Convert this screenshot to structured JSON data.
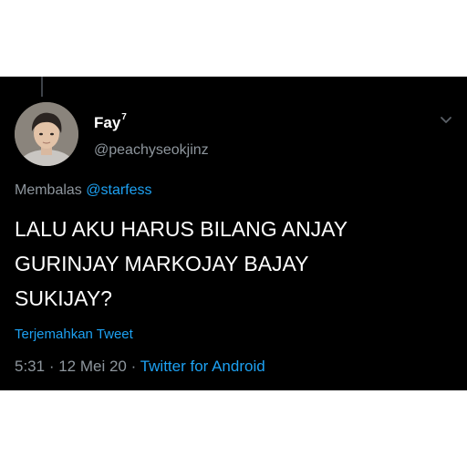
{
  "user": {
    "name": "Fay",
    "name_suffix": "7",
    "handle": "@peachyseokjinz",
    "avatar_icon": "user-avatar"
  },
  "reply": {
    "prefix": "Membalas",
    "mention": "@starfess"
  },
  "tweet": {
    "text": "LALU AKU HARUS BILANG ANJAY\nGURINJAY MARKOJAY BAJAY\nSUKIJAY?"
  },
  "actions": {
    "translate_label": "Terjemahkan Tweet",
    "menu_icon": "chevron-down-icon"
  },
  "meta": {
    "time": "5:31",
    "separator_1": " · ",
    "date": "12 Mei 20",
    "separator_2": " · ",
    "client": "Twitter for Android"
  },
  "colors": {
    "background": "#000000",
    "text": "#ffffff",
    "secondary": "#8e969d",
    "accent": "#1da1f2"
  }
}
